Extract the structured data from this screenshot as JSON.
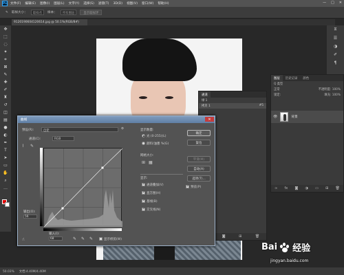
{
  "app": {
    "logo": "Ps"
  },
  "menu": [
    "文件(F)",
    "编辑(E)",
    "图像(I)",
    "图层(L)",
    "文字(Y)",
    "选择(S)",
    "滤镜(T)",
    "3D(D)",
    "视图(V)",
    "窗口(W)",
    "帮助(H)"
  ],
  "window_controls": [
    "—",
    "□",
    "✕"
  ],
  "options": {
    "sample_size_label": "取样大小：",
    "sample_size_value": "取样点",
    "sample_label": "样本：",
    "sample_value": "所有图层",
    "show_ring": "显示取样环"
  },
  "document": {
    "tab_title": "9120190604120614.jpg @ 50.1%(RGB/8#)"
  },
  "status": {
    "zoom": "50.03%",
    "doc_info": "文档:4.40M/4.40M"
  },
  "curves": {
    "title": "曲线",
    "preset_label": "预设(R):",
    "preset_value": "自定",
    "channel_label": "通道(C):",
    "channel_value": "RGB",
    "output_label": "输出(O):",
    "output_value": "56",
    "input_label": "输入(I):",
    "input_value": "68",
    "show_clipping": "显示修剪(W)",
    "display_amount": "显示数量:",
    "light": "光 (0-255)(L)",
    "pigment": "颜料/油墨 %(G)",
    "grid_size": "网格大小:",
    "show": "显示:",
    "options": [
      "通道叠加(V)",
      "直方图(H)",
      "基线(B)",
      "交叉线(N)"
    ],
    "buttons": {
      "ok": "确定",
      "reset": "复位",
      "smooth": "平滑(M)",
      "auto": "自动(A)",
      "options": "选项(T)..."
    },
    "preview": "预览(P)"
  },
  "channels_panel": {
    "tabs": [
      "通道"
    ],
    "rows": [
      {
        "name": "绿 1",
        "shortcut": ""
      },
      {
        "name": "拷贝 1",
        "shortcut": "#5"
      }
    ]
  },
  "layers_panel": {
    "tabs": [
      "图层",
      "历史记录",
      "颜色"
    ],
    "kind_label": "Q 类型",
    "blend_mode": "正常",
    "opacity": "不透明度: 100%",
    "lock": "锁定:",
    "fill": "填充: 100%",
    "layer_name": "背景"
  },
  "watermark": {
    "brand": "Bai",
    "brand2": "经验",
    "url": "jingyan.baidu.com"
  }
}
